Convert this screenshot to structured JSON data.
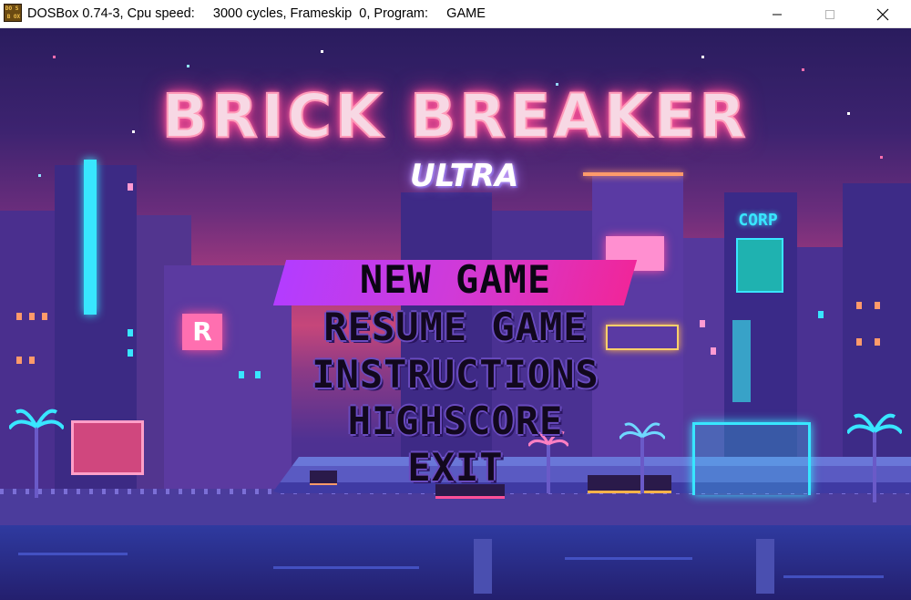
{
  "window": {
    "title": "DOSBox 0.74-3, Cpu speed:     3000 cycles, Frameskip  0, Program:     GAME",
    "icon_letters": [
      "DO",
      "S",
      "B",
      "OX"
    ],
    "controls": [
      "minimize-icon",
      "maximize-icon",
      "close-icon"
    ]
  },
  "game": {
    "title": "BRICK BREAKER",
    "subtitle": "ULTRA",
    "menu": [
      {
        "label": "NEW GAME",
        "selected": true
      },
      {
        "label": "RESUME GAME",
        "selected": false
      },
      {
        "label": "INSTRUCTIONS",
        "selected": false
      },
      {
        "label": "HIGHSCORE",
        "selected": false
      },
      {
        "label": "EXIT",
        "selected": false
      }
    ],
    "signs": {
      "corp": "CORP",
      "r_sign": "R"
    }
  },
  "colors": {
    "highlight_start": "#b33cff",
    "highlight_end": "#f0269a",
    "neon_pink": "#ff4f97",
    "neon_cyan": "#38e6ff",
    "menu_text": "#12081e"
  }
}
